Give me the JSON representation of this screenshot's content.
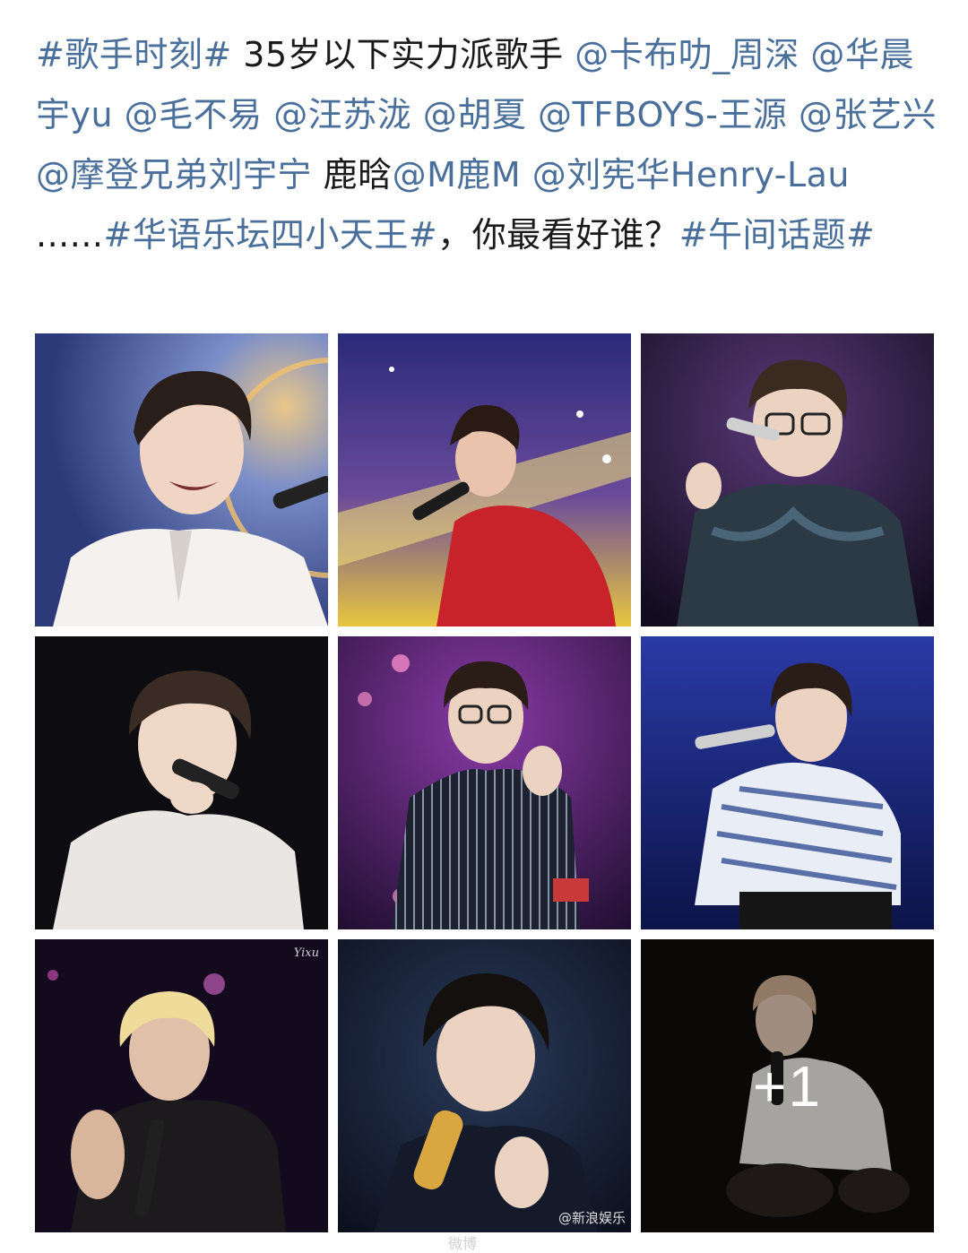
{
  "post": {
    "segments": [
      {
        "text": "#歌手时刻#",
        "type": "hashtag"
      },
      {
        "text": " 35岁以下实力派歌手 ",
        "type": "plain"
      },
      {
        "text": "@卡布叻_周深",
        "type": "mention"
      },
      {
        "text": " ",
        "type": "plain"
      },
      {
        "text": "@华晨宇yu",
        "type": "mention"
      },
      {
        "text": "  ",
        "type": "plain"
      },
      {
        "text": "@毛不易",
        "type": "mention"
      },
      {
        "text": "  ",
        "type": "plain"
      },
      {
        "text": "@汪苏泷",
        "type": "mention"
      },
      {
        "text": "  ",
        "type": "plain"
      },
      {
        "text": "@胡夏",
        "type": "mention"
      },
      {
        "text": " ",
        "type": "plain"
      },
      {
        "text": "@TFBOYS-王源",
        "type": "mention"
      },
      {
        "text": "  ",
        "type": "plain"
      },
      {
        "text": "@张艺兴",
        "type": "mention"
      },
      {
        "text": "  ",
        "type": "plain"
      },
      {
        "text": "@摩登兄弟刘宇宁",
        "type": "mention"
      },
      {
        "text": " 鹿晗",
        "type": "plain"
      },
      {
        "text": "@M鹿M",
        "type": "mention"
      },
      {
        "text": " ",
        "type": "plain"
      },
      {
        "text": "@刘宪华Henry-Lau",
        "type": "mention"
      },
      {
        "text": " ......",
        "type": "plain"
      },
      {
        "text": "#华语乐坛四小天王#",
        "type": "hashtag"
      },
      {
        "text": "，你最看好谁？",
        "type": "plain"
      },
      {
        "text": "#午间话题#",
        "type": "hashtag"
      }
    ]
  },
  "colors": {
    "link": "#4a6f9b",
    "text": "#1a1a1a",
    "background": "#ffffff"
  },
  "gallery": {
    "images": [
      {
        "subject": "singer-white-suit-smiling"
      },
      {
        "subject": "singer-red-jacket-yellow-lights"
      },
      {
        "subject": "singer-glasses-velvet-jacket"
      },
      {
        "subject": "singer-white-jacket-microphone"
      },
      {
        "subject": "singer-pinstripe-suit-glasses"
      },
      {
        "subject": "singer-striped-shirt-blue-stage"
      },
      {
        "subject": "singer-blonde-tank-top",
        "signature": "Yixu"
      },
      {
        "subject": "singer-golden-microphone",
        "watermark": "@新浪娱乐"
      },
      {
        "subject": "singer-white-tee-crouching",
        "overlay": "+1"
      }
    ]
  },
  "feed_watermark": "微博"
}
